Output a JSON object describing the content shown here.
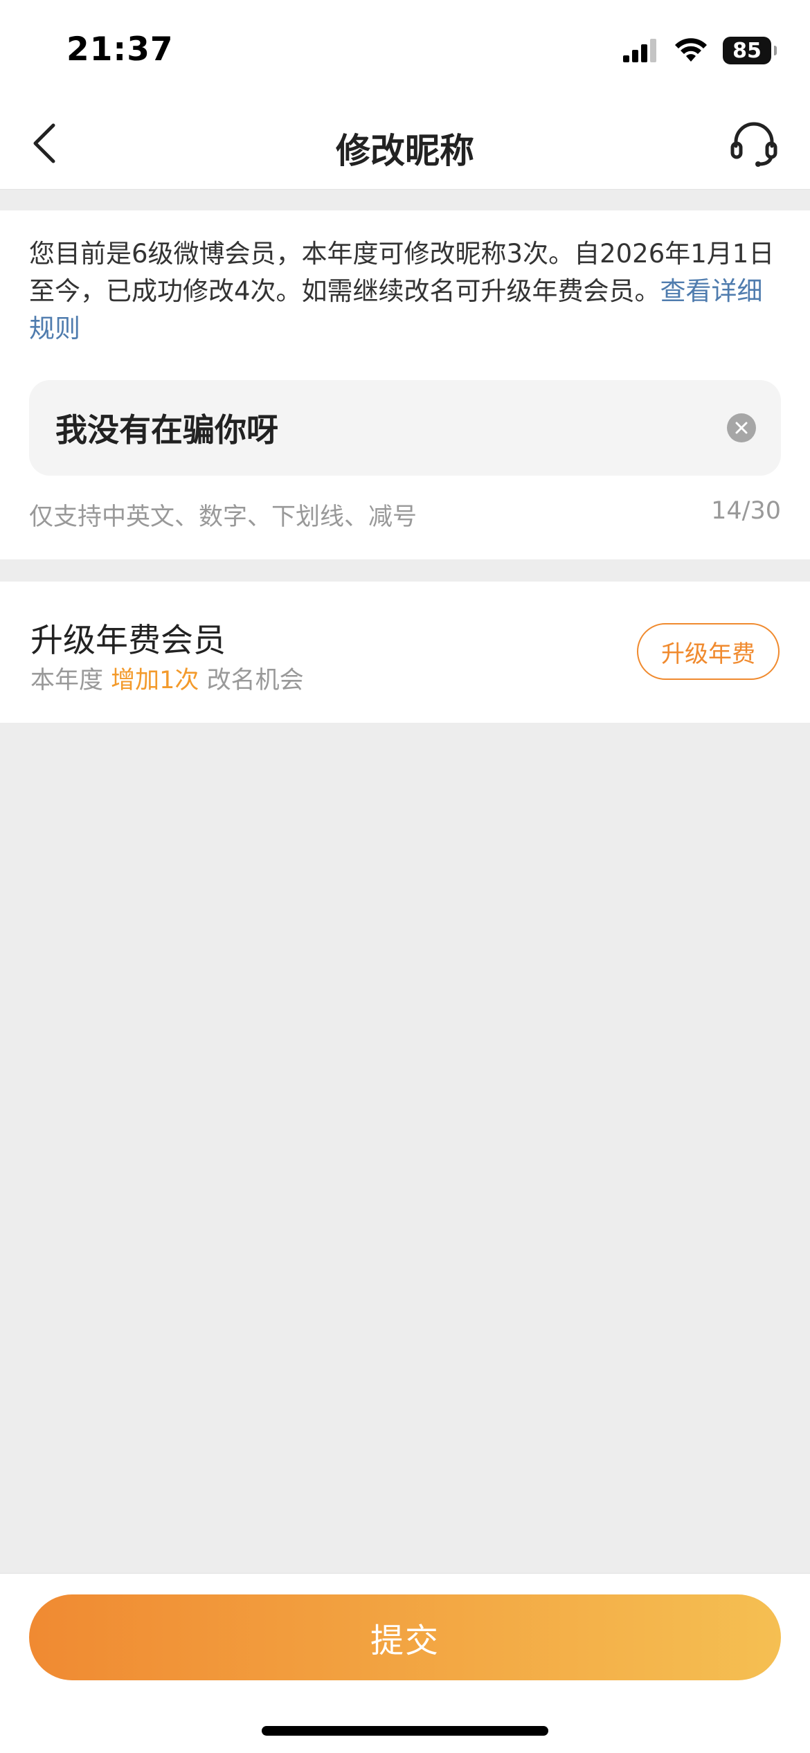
{
  "status_bar": {
    "time": "21:37",
    "battery": "85",
    "icons": [
      "cellular-signal-icon",
      "wifi-icon",
      "battery-icon"
    ]
  },
  "nav": {
    "title": "修改昵称",
    "back_icon": "chevron-left-icon",
    "service_icon": "headset-icon"
  },
  "notice": {
    "text": "您目前是6级微博会员，本年度可修改昵称3次。自2026年1月1日至今，已成功修改4次。如需继续改名可升级年费会员。",
    "link": "查看详细规则"
  },
  "nickname": {
    "value": "我没有在骗你呀",
    "hint": "仅支持中英文、数字、下划线、减号",
    "count": "14/30"
  },
  "upgrade": {
    "title": "升级年费会员",
    "sub_prefix": "本年度",
    "sub_highlight": "增加1次",
    "sub_suffix": "改名机会",
    "button": "升级年费"
  },
  "submit": {
    "label": "提交"
  },
  "colors": {
    "accent_orange": "#f08a2e",
    "link_blue": "#4f7cae",
    "gradient_start": "#f08a32",
    "gradient_end": "#f5bf52"
  }
}
